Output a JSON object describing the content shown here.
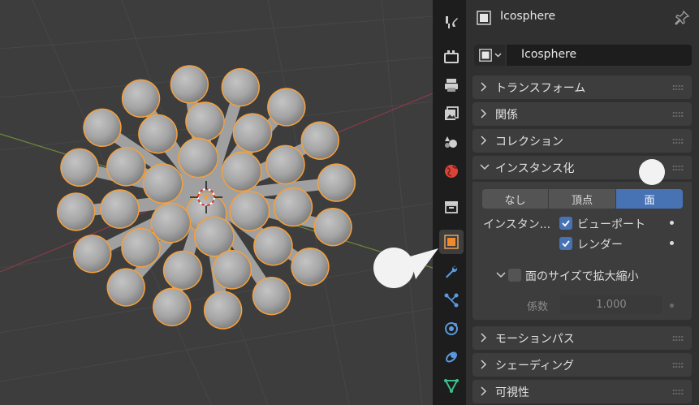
{
  "header": {
    "title": "Icosphere"
  },
  "object_field": {
    "value": "Icosphere"
  },
  "sections": {
    "transform": "トランスフォーム",
    "relations": "関係",
    "collections": "コレクション",
    "instancing": "インスタンス化",
    "motion_paths": "モーションパス",
    "shading": "シェーディング",
    "visibility": "可視性"
  },
  "instancing": {
    "modes": [
      "なし",
      "頂点",
      "面"
    ],
    "selected_mode": "面",
    "show_label": "インスタン...",
    "viewport_label": "ビューポート",
    "render_label": "レンダー",
    "scale_by_face_label": "面のサイズで拡大縮小",
    "factor_label": "係数",
    "factor_value": "1.000"
  },
  "tabs": [
    "tool-icon",
    "render-icon",
    "output-icon",
    "view-layer-icon",
    "scene-icon",
    "world-icon",
    "collection-icon",
    "object-icon",
    "modifier-icon",
    "particles-icon",
    "physics-icon",
    "constraints-icon",
    "data-icon"
  ],
  "colors": {
    "accent_blue": "#4772b3",
    "selection_orange": "#f5a03c",
    "panel_bg": "#303030",
    "section_bg": "#3d3d3d"
  }
}
